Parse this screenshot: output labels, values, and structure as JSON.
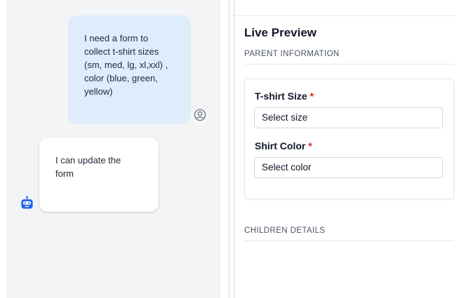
{
  "chat": {
    "messages": [
      {
        "role": "user",
        "lines": [
          "I need a form to",
          "collect t-shirt sizes",
          "(sm, med, lg, xl,xxl) ,",
          "color (blue, green,",
          "yellow)"
        ]
      },
      {
        "role": "bot",
        "lines": [
          "I can update the",
          "form"
        ]
      }
    ],
    "icons": {
      "user_avatar": "user-circle-icon",
      "bot_avatar": "robot-icon"
    }
  },
  "preview": {
    "title": "Live Preview",
    "sections": [
      {
        "label": "PARENT INFORMATION"
      },
      {
        "label": "CHILDREN DETAILS"
      }
    ],
    "fields": [
      {
        "label": "T-shirt Size",
        "required_mark": "*",
        "placeholder": "Select size"
      },
      {
        "label": "Shirt Color",
        "required_mark": "*",
        "placeholder": "Select color"
      }
    ]
  },
  "colors": {
    "user_bubble": "#deecfb",
    "chat_background": "#f3f4f6",
    "bot_icon": "#2563eb",
    "required": "#dc2626"
  }
}
